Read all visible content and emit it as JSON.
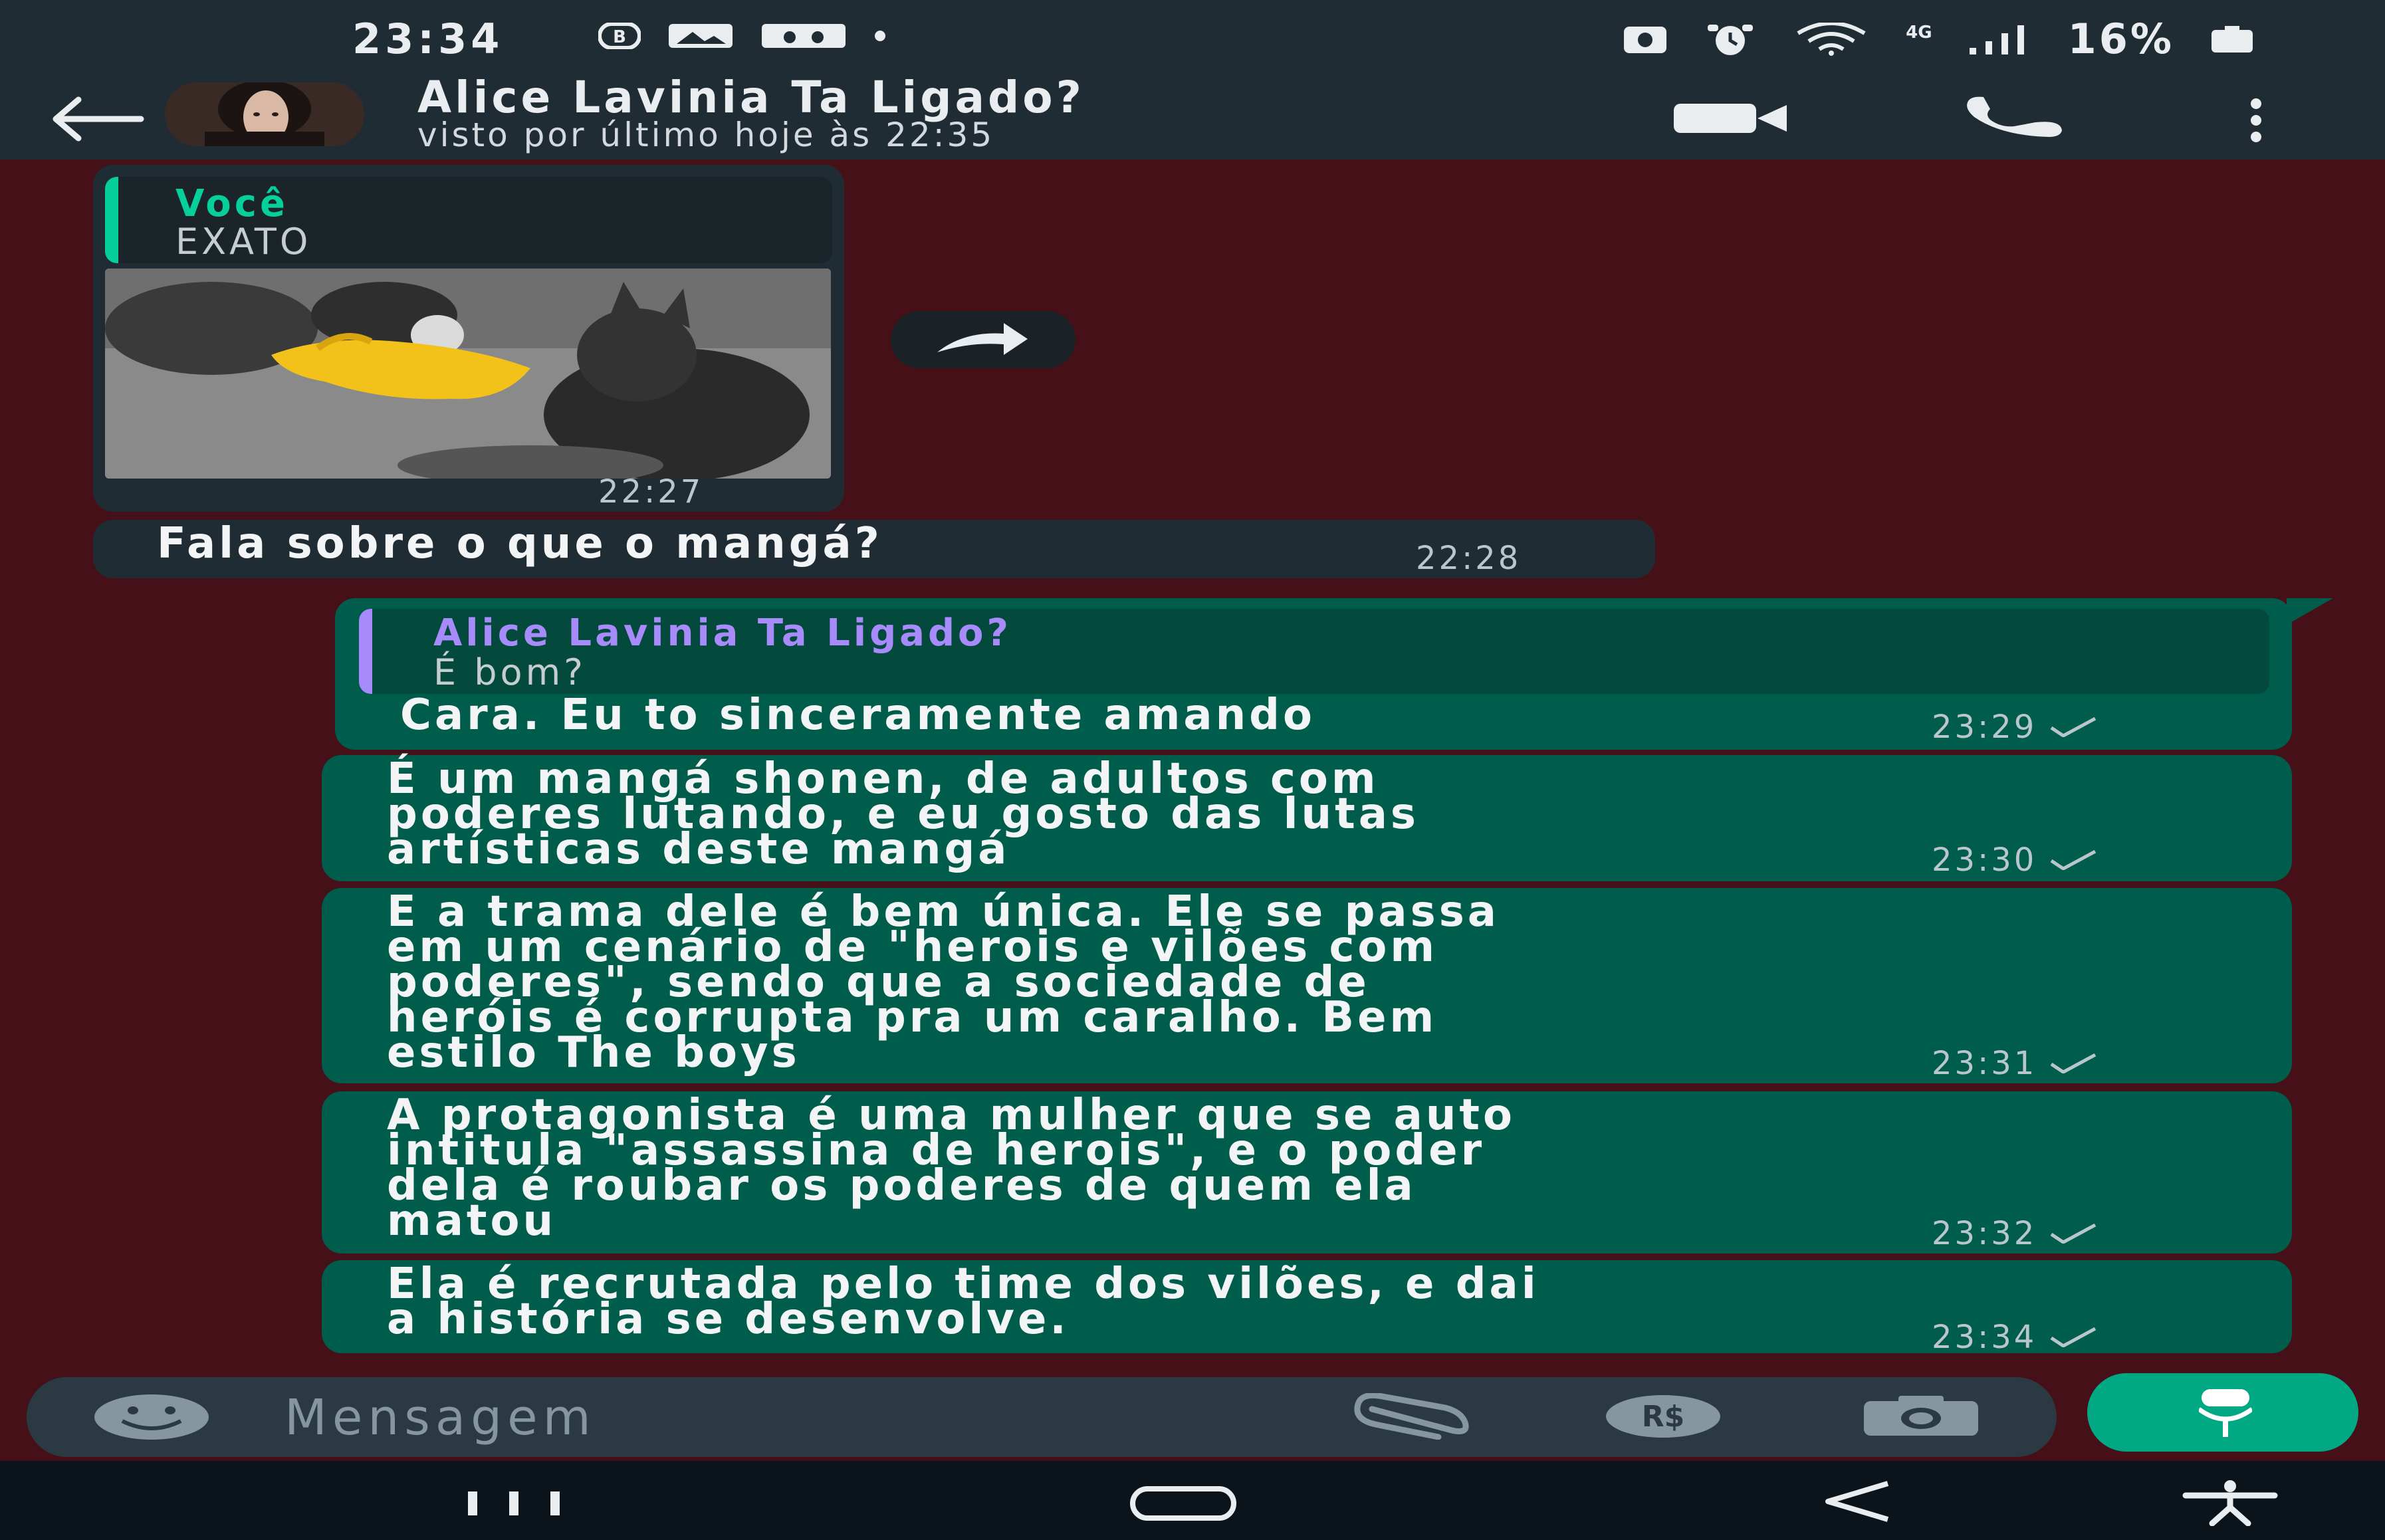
{
  "status_bar": {
    "time": "23:34",
    "network": "4G",
    "battery_percent": "16%"
  },
  "header": {
    "contact_name": "Alice Lavinia Ta Ligado?",
    "last_seen": "visto por último hoje às 22:35"
  },
  "messages": [
    {
      "direction": "incoming",
      "quote_author": "Você",
      "quote_text": "EXATO",
      "has_image": true,
      "time": "22:27"
    },
    {
      "direction": "incoming",
      "text": "Fala sobre o que o mangá?",
      "time": "22:28"
    },
    {
      "direction": "outgoing",
      "quote_author": "Alice Lavinia Ta Ligado?",
      "quote_text": "É bom?",
      "text": "Cara. Eu to sinceramente amando",
      "time": "23:29"
    },
    {
      "direction": "outgoing",
      "text": "É um mangá shonen, de adultos com\npoderes lutando, e eu gosto das lutas\nartísticas deste mangá",
      "time": "23:30"
    },
    {
      "direction": "outgoing",
      "text": "E a trama dele é bem única. Ele se passa\nem um cenário de \"herois e vilões com\npoderes\", sendo que a sociedade de\nheróis é corrupta pra um caralho. Bem\nestilo The boys",
      "time": "23:31"
    },
    {
      "direction": "outgoing",
      "text": "A protagonista é uma mulher que se auto\nintitula \"assassina de herois\", e o poder\ndela é roubar os poderes de quem ela\nmatou",
      "time": "23:32"
    },
    {
      "direction": "outgoing",
      "text": "Ela é recrutada pelo time dos vilões, e dai\na história se desenvolve.",
      "time": "23:34"
    }
  ],
  "input": {
    "placeholder": "Mensagem"
  },
  "colors": {
    "chat_background": "#451018",
    "incoming_bubble": "#202c33",
    "outgoing_bubble": "#005c4b",
    "accent_green": "#00a884",
    "quote_author_self": "#06cf9c",
    "quote_author_contact": "#a78bfa"
  },
  "icons": {
    "header": [
      "back-arrow-icon",
      "video-call-icon",
      "voice-call-icon",
      "more-options-icon"
    ],
    "input": [
      "emoji-icon",
      "attach-icon",
      "payment-icon",
      "camera-icon",
      "microphone-icon"
    ],
    "nav": [
      "recents-icon",
      "home-icon",
      "back-icon",
      "accessibility-icon"
    ]
  }
}
